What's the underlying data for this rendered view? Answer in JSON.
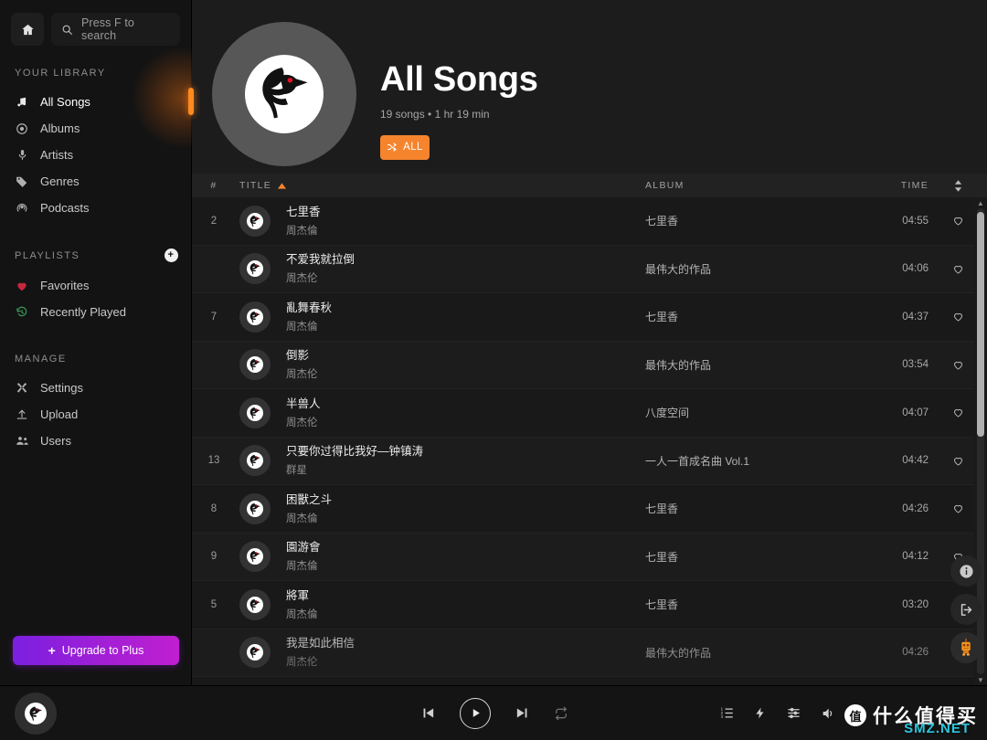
{
  "colors": {
    "accent_orange": "#f5842d",
    "handle_orange": "#ff8a1f",
    "upgrade_from": "#7b1fe0",
    "upgrade_to": "#c01fd0",
    "favorite_red": "#c5283d",
    "recent_green": "#3a9c5a",
    "watermark_cyan": "#2fd0e8",
    "sidebar_bg": "#131313",
    "main_bg": "#181818"
  },
  "sidebar": {
    "home_icon": "home-icon",
    "search": {
      "placeholder": "Press F to search",
      "icon": "search-icon"
    },
    "library_label": "YOUR LIBRARY",
    "library_items": [
      {
        "label": "All Songs",
        "icon": "music-note-icon",
        "active": true
      },
      {
        "label": "Albums",
        "icon": "disc-icon",
        "active": false
      },
      {
        "label": "Artists",
        "icon": "microphone-icon",
        "active": false
      },
      {
        "label": "Genres",
        "icon": "tag-icon",
        "active": false
      },
      {
        "label": "Podcasts",
        "icon": "podcast-icon",
        "active": false
      }
    ],
    "playlists_label": "PLAYLISTS",
    "add_playlist_label": "+",
    "playlist_items": [
      {
        "label": "Favorites",
        "icon": "heart-icon"
      },
      {
        "label": "Recently Played",
        "icon": "history-icon"
      }
    ],
    "manage_label": "MANAGE",
    "manage_items": [
      {
        "label": "Settings",
        "icon": "tools-icon"
      },
      {
        "label": "Upload",
        "icon": "upload-icon"
      },
      {
        "label": "Users",
        "icon": "users-icon"
      }
    ],
    "upgrade": {
      "plus": "+",
      "label": "Upgrade to Plus"
    }
  },
  "hero": {
    "title": "All Songs",
    "subtitle": "19 songs • 1 hr 19 min",
    "shuffle_label": "ALL",
    "shuffle_icon": "shuffle-icon",
    "cover_icon": "bird-logo-icon"
  },
  "table": {
    "headers": {
      "num": "#",
      "title": "TITLE",
      "album": "ALBUM",
      "time": "TIME"
    },
    "sort_asc_icon": "caret-up-icon",
    "sort_toggle_icon": "sort-updown-icon",
    "rows": [
      {
        "num": "2",
        "title": "七里香",
        "artist": "周杰倫",
        "album": "七里香",
        "time": "04:55"
      },
      {
        "num": "",
        "title": "不爱我就拉倒",
        "artist": "周杰伦",
        "album": "最伟大的作品",
        "time": "04:06"
      },
      {
        "num": "7",
        "title": "亂舞春秋",
        "artist": "周杰倫",
        "album": "七里香",
        "time": "04:37"
      },
      {
        "num": "",
        "title": "倒影",
        "artist": "周杰伦",
        "album": "最伟大的作品",
        "time": "03:54"
      },
      {
        "num": "",
        "title": "半兽人",
        "artist": "周杰伦",
        "album": "八度空间",
        "time": "04:07"
      },
      {
        "num": "13",
        "title": "只要你过得比我好—钟镇涛",
        "artist": "群星",
        "album": "一人一首成名曲 Vol.1",
        "time": "04:42"
      },
      {
        "num": "8",
        "title": "困獸之斗",
        "artist": "周杰倫",
        "album": "七里香",
        "time": "04:26"
      },
      {
        "num": "9",
        "title": "園游會",
        "artist": "周杰倫",
        "album": "七里香",
        "time": "04:12"
      },
      {
        "num": "5",
        "title": "將軍",
        "artist": "周杰倫",
        "album": "七里香",
        "time": "03:20"
      },
      {
        "num": "",
        "title": "我是如此相信",
        "artist": "周杰伦",
        "album": "最伟大的作品",
        "time": "04:26"
      }
    ],
    "favorite_icon": "heart-outline-icon"
  },
  "float_buttons": [
    {
      "icon": "info-icon",
      "name": "info-button"
    },
    {
      "icon": "logout-icon",
      "name": "logout-button"
    },
    {
      "icon": "robot-mascot-icon",
      "name": "mascot-button"
    }
  ],
  "player": {
    "now_playing_art_icon": "bird-logo-icon",
    "prev_icon": "skip-previous-icon",
    "play_icon": "play-icon",
    "next_icon": "skip-next-icon",
    "repeat_icon": "repeat-icon",
    "queue_icon": "queue-list-icon",
    "boost_icon": "lightning-icon",
    "equalizer_icon": "equalizer-icon",
    "volume_icon": "volume-icon"
  },
  "watermark": {
    "badge": "值",
    "text": "什么值得买",
    "overlay": "SMZ.NET"
  }
}
